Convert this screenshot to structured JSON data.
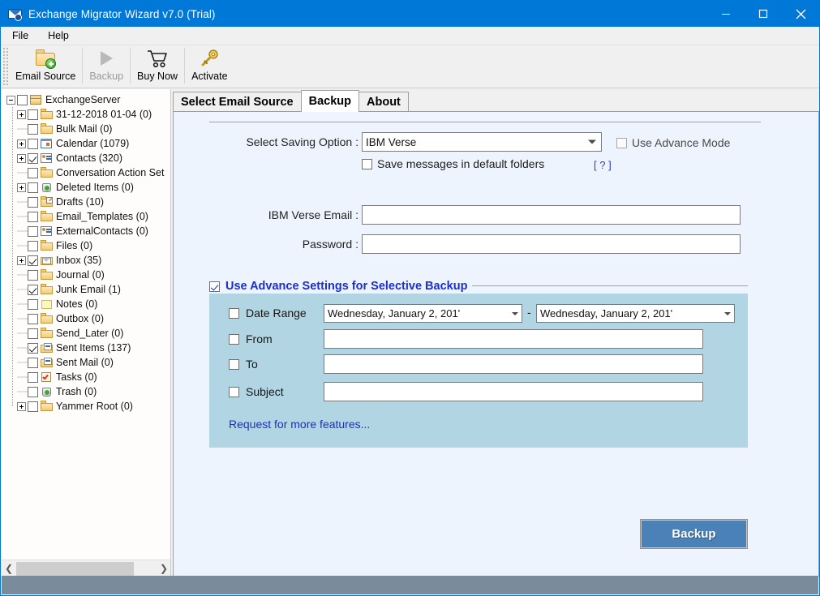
{
  "window": {
    "title": "Exchange Migrator Wizard v7.0 (Trial)",
    "icon": "mail-app-icon",
    "minimize_label": "–",
    "maximize_label": "□",
    "close_label": "✕"
  },
  "menubar": {
    "items": [
      {
        "label": "File"
      },
      {
        "label": "Help"
      }
    ]
  },
  "toolbar": {
    "buttons": [
      {
        "label": "Email Source",
        "icon": "folder-add-icon",
        "enabled": true
      },
      {
        "label": "Backup",
        "icon": "play-icon",
        "enabled": false
      },
      {
        "label": "Buy Now",
        "icon": "shopping-cart-icon",
        "enabled": true
      },
      {
        "label": "Activate",
        "icon": "key-icon",
        "enabled": true
      }
    ]
  },
  "tree": {
    "root": {
      "label": "ExchangeServer",
      "count": null,
      "checked": false,
      "expanded": true,
      "icon": "folder-stack-icon"
    },
    "items": [
      {
        "label": "31-12-2018 01-04 (0)",
        "checked": false,
        "expandable": true,
        "icon": "folder-icon"
      },
      {
        "label": "Bulk Mail (0)",
        "checked": false,
        "expandable": false,
        "icon": "folder-icon"
      },
      {
        "label": "Calendar (1079)",
        "checked": false,
        "expandable": true,
        "icon": "calendar-icon"
      },
      {
        "label": "Contacts (320)",
        "checked": true,
        "expandable": true,
        "icon": "contact-card-icon"
      },
      {
        "label": "Conversation Action Set",
        "checked": false,
        "expandable": false,
        "icon": "folder-icon"
      },
      {
        "label": "Deleted Items (0)",
        "checked": false,
        "expandable": true,
        "icon": "trash-icon"
      },
      {
        "label": "Drafts (10)",
        "checked": false,
        "expandable": false,
        "icon": "drafts-icon"
      },
      {
        "label": "Email_Templates (0)",
        "checked": false,
        "expandable": false,
        "icon": "folder-icon"
      },
      {
        "label": "ExternalContacts (0)",
        "checked": false,
        "expandable": false,
        "icon": "contact-card-icon"
      },
      {
        "label": "Files (0)",
        "checked": false,
        "expandable": false,
        "icon": "folder-icon"
      },
      {
        "label": "Inbox (35)",
        "checked": true,
        "expandable": true,
        "icon": "inbox-icon"
      },
      {
        "label": "Journal (0)",
        "checked": false,
        "expandable": false,
        "icon": "folder-icon"
      },
      {
        "label": "Junk Email (1)",
        "checked": true,
        "expandable": false,
        "icon": "folder-icon"
      },
      {
        "label": "Notes (0)",
        "checked": false,
        "expandable": false,
        "icon": "notes-icon"
      },
      {
        "label": "Outbox (0)",
        "checked": false,
        "expandable": false,
        "icon": "folder-icon"
      },
      {
        "label": "Send_Later (0)",
        "checked": false,
        "expandable": false,
        "icon": "folder-icon"
      },
      {
        "label": "Sent Items (137)",
        "checked": true,
        "expandable": false,
        "icon": "sent-icon"
      },
      {
        "label": "Sent Mail (0)",
        "checked": false,
        "expandable": false,
        "icon": "sent-icon"
      },
      {
        "label": "Tasks (0)",
        "checked": false,
        "expandable": false,
        "icon": "tasks-icon"
      },
      {
        "label": "Trash (0)",
        "checked": false,
        "expandable": false,
        "icon": "trash-icon"
      },
      {
        "label": "Yammer Root (0)",
        "checked": false,
        "expandable": true,
        "icon": "folder-icon"
      }
    ],
    "hscroll": {
      "left_arrow": "❮",
      "right_arrow": "❯"
    }
  },
  "tabs": [
    {
      "label": "Select Email Source",
      "active": false
    },
    {
      "label": "Backup",
      "active": true
    },
    {
      "label": "About",
      "active": false
    }
  ],
  "form": {
    "saving_option_label": "Select Saving Option :",
    "saving_option_value": "IBM Verse",
    "saving_option_choices": [
      "IBM Verse"
    ],
    "use_advance_mode_label": "Use Advance Mode",
    "use_advance_mode_checked": false,
    "save_default_folders_label": "Save messages in default folders",
    "save_default_folders_checked": false,
    "help_marker": "[ ? ]",
    "email_label": "IBM Verse Email :",
    "email_value": "",
    "password_label": "Password :",
    "password_value": ""
  },
  "advance": {
    "group_label": "Use Advance Settings for Selective Backup",
    "group_checked": true,
    "date_range_label": "Date Range",
    "date_range_checked": false,
    "date_from_value": "Wednesday,    January      2, 201'",
    "date_to_value": "Wednesday,    January      2, 201'",
    "date_separator": "-",
    "from_label": "From",
    "from_checked": false,
    "from_value": "",
    "to_label": "To",
    "to_checked": false,
    "to_value": "",
    "subject_label": "Subject",
    "subject_checked": false,
    "subject_value": "",
    "request_link": "Request for more features..."
  },
  "actions": {
    "backup_button_label": "Backup"
  },
  "colors": {
    "titlebar": "#0078d7",
    "panel_bg": "#eef4fd",
    "advance_bg": "#b1d5e3",
    "accent_link": "#1a2fcc",
    "backup_button": "#4a82b8",
    "statusbar": "#7a8b9b"
  }
}
